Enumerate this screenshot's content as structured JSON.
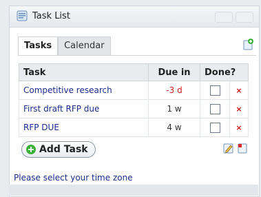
{
  "window": {
    "title": "Task List"
  },
  "tabs": [
    {
      "label": "Tasks"
    },
    {
      "label": "Calendar"
    }
  ],
  "table": {
    "headers": {
      "task": "Task",
      "due": "Due in",
      "done": "Done?"
    },
    "rows": [
      {
        "task": "Competitive research",
        "due": "-3 d",
        "overdue": true
      },
      {
        "task": "First draft RFP due",
        "due": "1 w",
        "overdue": false
      },
      {
        "task": "RFP DUE",
        "due": "4 w",
        "overdue": false
      }
    ]
  },
  "actions": {
    "add_task_label": "Add Task",
    "delete_glyph": "×"
  },
  "footer": {
    "timezone_link": "Please select your time zone"
  },
  "colors": {
    "link": "#1a2c8e",
    "overdue": "#d42020",
    "delete": "#cc1111",
    "add": "#3bb13b"
  }
}
